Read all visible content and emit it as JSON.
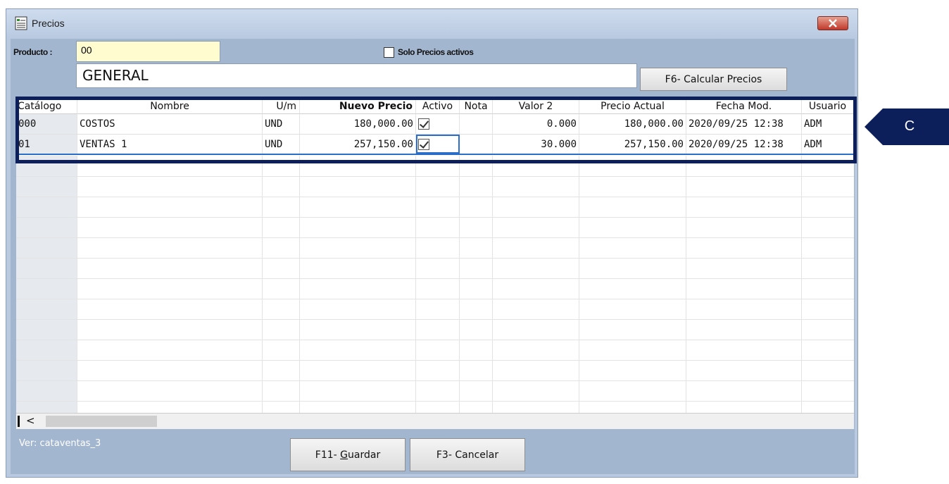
{
  "window": {
    "title": "Precios"
  },
  "product": {
    "label": "Producto :",
    "code": "00",
    "name": "GENERAL",
    "only_active_label": "Solo Precios activos",
    "calc_button": "F6- Calcular Precios"
  },
  "grid": {
    "headers": [
      "Catálogo",
      "Nombre",
      "U/m",
      "Nuevo Precio",
      "Activo",
      "Nota",
      "Valor 2",
      "Precio Actual",
      "Fecha Mod.",
      "Usuario"
    ],
    "rows": [
      {
        "catalogo": "000",
        "nombre": "COSTOS",
        "um": "UND",
        "nuevo_precio": "180,000.00",
        "activo": true,
        "nota": "",
        "valor2": "0.000",
        "precio_actual": "180,000.00",
        "fecha_mod": "2020/09/25 12:38",
        "usuario": "ADM"
      },
      {
        "catalogo": "01",
        "nombre": "VENTAS 1",
        "um": "UND",
        "nuevo_precio": "257,150.00",
        "activo": true,
        "nota": "",
        "valor2": "30.000",
        "precio_actual": "257,150.00",
        "fecha_mod": "2020/09/25 12:38",
        "usuario": "ADM"
      }
    ],
    "scroll_left": "<"
  },
  "footer": {
    "version": "Ver: cataventas_3",
    "save_button": "F11- Guardar",
    "cancel_button": "F3- Cancelar"
  },
  "callout": {
    "label": "C"
  },
  "colors": {
    "highlight": "#0c1f5a",
    "window_bg": "#a3b6d0",
    "accent": "#2b6ec9"
  }
}
